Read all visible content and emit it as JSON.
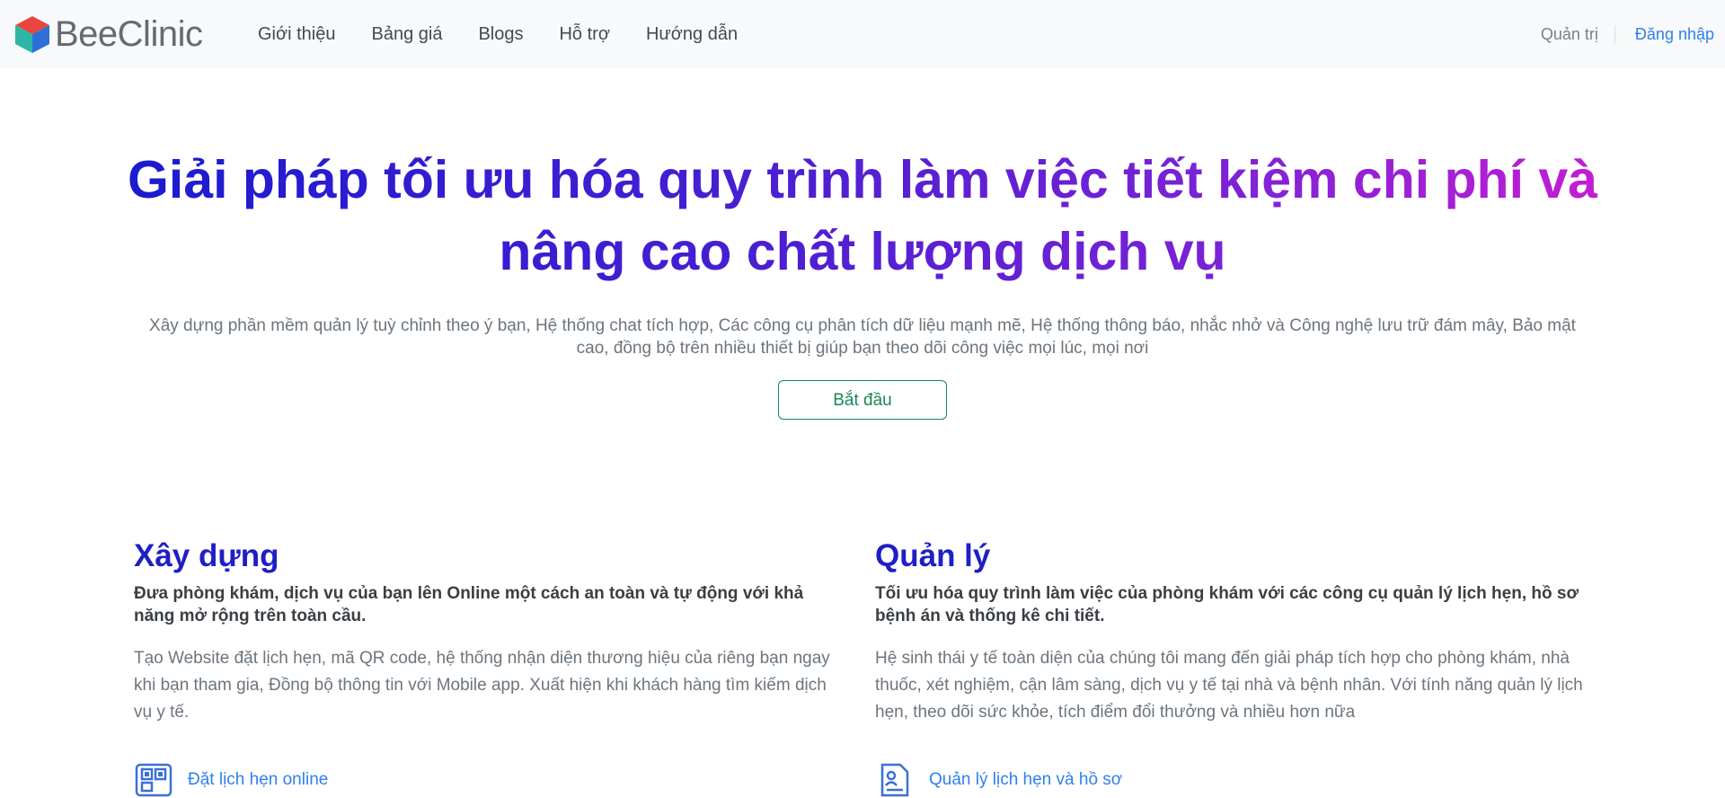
{
  "nav": {
    "brand": "BeeClinic",
    "links": [
      "Giới thiệu",
      "Bảng giá",
      "Blogs",
      "Hỗ trợ",
      "Hướng dẫn"
    ],
    "admin": "Quản trị",
    "login": "Đăng nhập"
  },
  "hero": {
    "title_line1": "Giải pháp tối ưu hóa quy trình làm việc tiết kiệm chi phí và",
    "title_line2": "nâng cao chất lượng dịch vụ",
    "subtitle": "Xây dựng phần mềm quản lý tuỳ chỉnh theo ý bạn, Hệ thống chat tích hợp, Các công cụ phân tích dữ liệu mạnh mẽ, Hệ thống thông báo, nhắc nhở và Công nghệ lưu trữ đám mây, Bảo mật cao, đồng bộ trên nhiều thiết bị giúp bạn theo dõi công việc mọi lúc, mọi nơi",
    "button": "Bắt đầu"
  },
  "features": [
    {
      "title": "Xây dựng",
      "lead": "Đưa phòng khám, dịch vụ của bạn lên Online một cách an toàn và tự động với khả năng mở rộng trên toàn cầu.",
      "body": "Tạo Website đặt lịch hẹn, mã QR code, hệ thống nhận diện thương hiệu của riêng bạn ngay khi bạn tham gia, Đồng bộ thông tin với Mobile app. Xuất hiện khi khách hàng tìm kiếm dịch vụ y tế.",
      "link": "Đặt lịch hẹn online",
      "icon": "qr-code-icon"
    },
    {
      "title": "Quản lý",
      "lead": "Tối ưu hóa quy trình làm việc của phòng khám với các công cụ quản lý lịch hẹn, hồ sơ bệnh án và thống kê chi tiết.",
      "body": "Hệ sinh thái y tế toàn diện của chúng tôi mang đến giải pháp tích hợp cho phòng khám, nhà thuốc, xét nghiệm, cận lâm sàng, dịch vụ y tế tại nhà và bệnh nhân. Với tính năng quản lý lịch hẹn, theo dõi sức khỏe, tích điểm đổi thưởng và nhiều hơn nữa",
      "link": "Quản lý lịch hẹn và hồ sơ",
      "icon": "medical-record-icon"
    }
  ],
  "colors": {
    "accent": "#2f80ed",
    "success": "#198754",
    "title_gradient": [
      "#1b1bd0",
      "#4c1fd2",
      "#7d22d6",
      "#c41dd4"
    ],
    "feature_title": "#1f1fc4"
  }
}
